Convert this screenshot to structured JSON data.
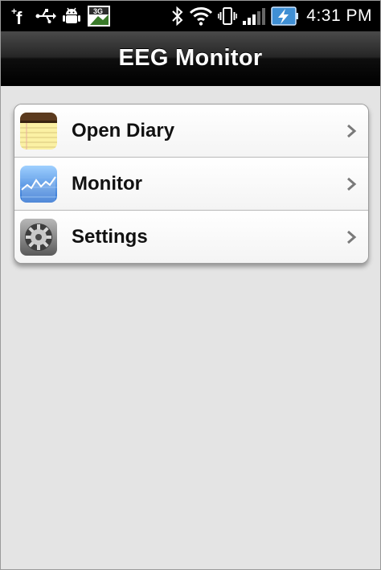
{
  "status_bar": {
    "time": "4:31 PM",
    "icons": [
      "facebook-notification-icon",
      "usb-icon",
      "android-debug-icon",
      "3g-data-icon",
      "bluetooth-icon",
      "wifi-icon",
      "vibrate-icon",
      "signal-icon",
      "battery-charging-icon"
    ],
    "net_label": "3G"
  },
  "header": {
    "title": "EEG Monitor"
  },
  "menu": {
    "items": [
      {
        "label": "Open Diary",
        "icon": "notepad-icon"
      },
      {
        "label": "Monitor",
        "icon": "chart-icon"
      },
      {
        "label": "Settings",
        "icon": "settings-gear-icon"
      }
    ]
  },
  "colors": {
    "background": "#e4e4e4",
    "title_bar": "#000000",
    "list_background": "#ffffff",
    "text": "#111111"
  }
}
